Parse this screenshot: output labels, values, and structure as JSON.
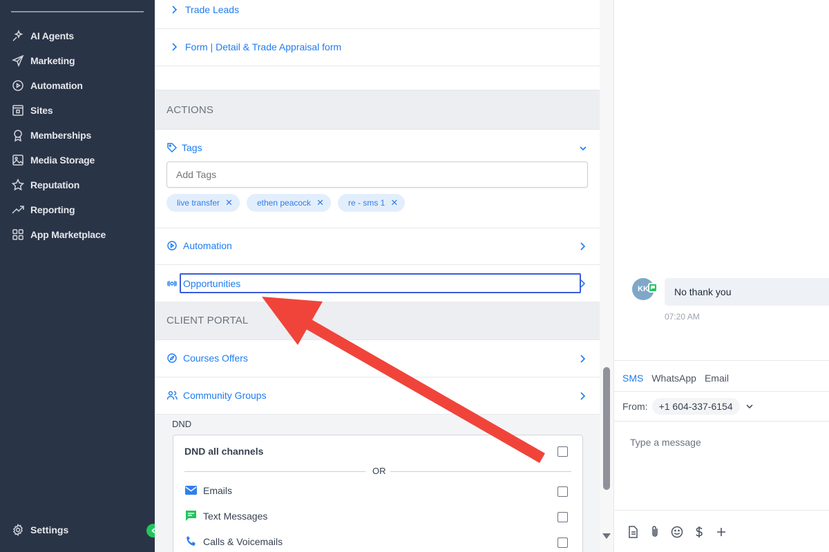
{
  "sidebar": {
    "items": [
      {
        "label": "AI Agents",
        "icon": "sparkle-icon"
      },
      {
        "label": "Marketing",
        "icon": "send-icon"
      },
      {
        "label": "Automation",
        "icon": "automation-icon"
      },
      {
        "label": "Sites",
        "icon": "sites-icon"
      },
      {
        "label": "Memberships",
        "icon": "award-icon"
      },
      {
        "label": "Media Storage",
        "icon": "image-icon"
      },
      {
        "label": "Reputation",
        "icon": "star-icon"
      },
      {
        "label": "Reporting",
        "icon": "trend-icon"
      },
      {
        "label": "App Marketplace",
        "icon": "grid-icon"
      }
    ],
    "settings_label": "Settings"
  },
  "forms": {
    "trade_leads": "Trade Leads",
    "trade_appraisal": "Form | Detail & Trade Appraisal form"
  },
  "actions": {
    "heading": "ACTIONS",
    "tags_label": "Tags",
    "tags_placeholder": "Add Tags",
    "tags": [
      "live transfer",
      "ethen peacock",
      "re - sms 1"
    ],
    "automation_label": "Automation",
    "opportunities_label": "Opportunities"
  },
  "client_portal": {
    "heading": "CLIENT PORTAL",
    "courses_label": "Courses Offers",
    "community_label": "Community Groups"
  },
  "dnd": {
    "label": "DND",
    "all_channels": "DND all channels",
    "or": "OR",
    "options": [
      "Emails",
      "Text Messages",
      "Calls & Voicemails"
    ]
  },
  "conversation": {
    "avatar_initials": "KK",
    "message": "No thank you",
    "time": "07:20 AM",
    "channels": [
      "SMS",
      "WhatsApp",
      "Email"
    ],
    "from_label": "From:",
    "from_number": "+1 604-337-6154",
    "input_placeholder": "Type a message"
  },
  "colors": {
    "sidebar_bg": "#2a3447",
    "link_blue": "#1d7cf2",
    "highlight_border": "#3b5bdb",
    "arrow_red": "#f0443a",
    "badge_green": "#22c55e"
  }
}
